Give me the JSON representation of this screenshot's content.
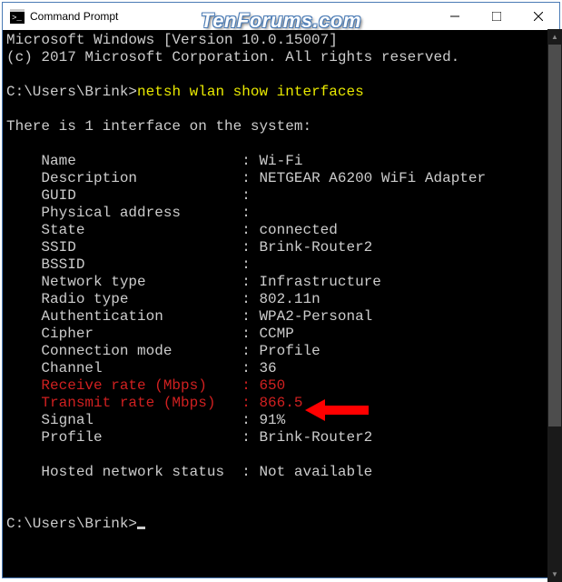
{
  "titlebar": {
    "title": "Command Prompt"
  },
  "watermark": "TenForums.com",
  "terminal": {
    "version_line": "Microsoft Windows [Version 10.0.15007]",
    "copyright_line": "(c) 2017 Microsoft Corporation. All rights reserved.",
    "prompt1_path": "C:\\Users\\Brink>",
    "command": "netsh wlan show interfaces",
    "interface_header": "There is 1 interface on the system:",
    "fields": {
      "name": {
        "label": "Name",
        "value": "Wi-Fi"
      },
      "description": {
        "label": "Description",
        "value": "NETGEAR A6200 WiFi Adapter"
      },
      "guid": {
        "label": "GUID",
        "value": ""
      },
      "physaddr": {
        "label": "Physical address",
        "value": ""
      },
      "state": {
        "label": "State",
        "value": "connected"
      },
      "ssid": {
        "label": "SSID",
        "value": "Brink-Router2"
      },
      "bssid": {
        "label": "BSSID",
        "value": ""
      },
      "nettype": {
        "label": "Network type",
        "value": "Infrastructure"
      },
      "radiotype": {
        "label": "Radio type",
        "value": "802.11n"
      },
      "auth": {
        "label": "Authentication",
        "value": "WPA2-Personal"
      },
      "cipher": {
        "label": "Cipher",
        "value": "CCMP"
      },
      "connmode": {
        "label": "Connection mode",
        "value": "Profile"
      },
      "channel": {
        "label": "Channel",
        "value": "36"
      },
      "rxrate": {
        "label": "Receive rate (Mbps)",
        "value": "650"
      },
      "txrate": {
        "label": "Transmit rate (Mbps)",
        "value": "866.5"
      },
      "signal": {
        "label": "Signal",
        "value": "91%"
      },
      "profile": {
        "label": "Profile",
        "value": "Brink-Router2"
      }
    },
    "hosted_label": "Hosted network status",
    "hosted_value": "Not available",
    "prompt2_path": "C:\\Users\\Brink>"
  }
}
